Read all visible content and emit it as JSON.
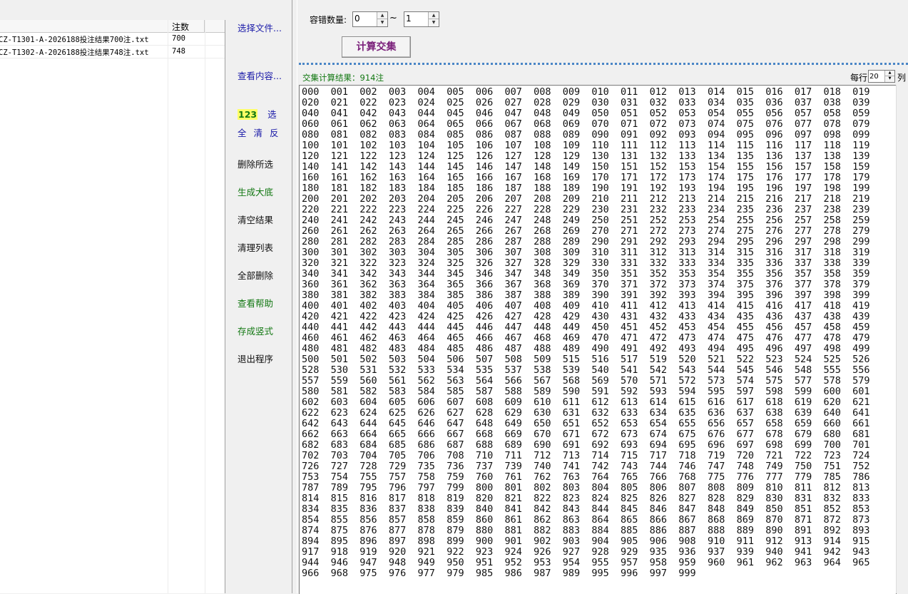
{
  "file_list": {
    "columns": [
      "",
      "注数"
    ],
    "rows": [
      {
        "name": "CZ-T1301-A-2026188投注结果700注.txt",
        "count": "700"
      },
      {
        "name": "CZ-T1302-A-2026188投注结果748注.txt",
        "count": "748"
      }
    ]
  },
  "middle": {
    "select_file": "选择文件...",
    "view_content": "查看内容...",
    "num_badge": "123",
    "select": "选",
    "select_all": "全",
    "clear": "清",
    "invert": "反",
    "delete_selected": "删除所选",
    "generate_base": "生成大底",
    "clear_result": "清空结果",
    "clean_list": "清理列表",
    "delete_all": "全部删除",
    "view_help": "查看帮助",
    "save_vertical": "存成竖式",
    "exit": "退出程序"
  },
  "controls": {
    "tolerance_label": "容错数量:",
    "tolerance_min": "0",
    "tilde": "~",
    "tolerance_max": "1",
    "calc_button": "计算交集"
  },
  "result": {
    "title": "交集计算结果：914注",
    "per_row_label": "每行",
    "per_row_value": "20",
    "per_row_unit": "列",
    "numbers": [
      "000",
      "001",
      "002",
      "003",
      "004",
      "005",
      "006",
      "007",
      "008",
      "009",
      "010",
      "011",
      "012",
      "013",
      "014",
      "015",
      "016",
      "017",
      "018",
      "019",
      "020",
      "021",
      "022",
      "023",
      "024",
      "025",
      "026",
      "027",
      "028",
      "029",
      "030",
      "031",
      "032",
      "033",
      "034",
      "035",
      "036",
      "037",
      "038",
      "039",
      "040",
      "041",
      "042",
      "043",
      "044",
      "045",
      "046",
      "047",
      "048",
      "049",
      "050",
      "051",
      "052",
      "053",
      "054",
      "055",
      "056",
      "057",
      "058",
      "059",
      "060",
      "061",
      "062",
      "063",
      "064",
      "065",
      "066",
      "067",
      "068",
      "069",
      "070",
      "071",
      "072",
      "073",
      "074",
      "075",
      "076",
      "077",
      "078",
      "079",
      "080",
      "081",
      "082",
      "083",
      "084",
      "085",
      "086",
      "087",
      "088",
      "089",
      "090",
      "091",
      "092",
      "093",
      "094",
      "095",
      "096",
      "097",
      "098",
      "099",
      "100",
      "101",
      "102",
      "103",
      "104",
      "105",
      "106",
      "107",
      "108",
      "109",
      "110",
      "111",
      "112",
      "113",
      "114",
      "115",
      "116",
      "117",
      "118",
      "119",
      "120",
      "121",
      "122",
      "123",
      "124",
      "125",
      "126",
      "127",
      "128",
      "129",
      "130",
      "131",
      "132",
      "133",
      "134",
      "135",
      "136",
      "137",
      "138",
      "139",
      "140",
      "141",
      "142",
      "143",
      "144",
      "145",
      "146",
      "147",
      "148",
      "149",
      "150",
      "151",
      "152",
      "153",
      "154",
      "155",
      "156",
      "157",
      "158",
      "159",
      "160",
      "161",
      "162",
      "163",
      "164",
      "165",
      "166",
      "167",
      "168",
      "169",
      "170",
      "171",
      "172",
      "173",
      "174",
      "175",
      "176",
      "177",
      "178",
      "179",
      "180",
      "181",
      "182",
      "183",
      "184",
      "185",
      "186",
      "187",
      "188",
      "189",
      "190",
      "191",
      "192",
      "193",
      "194",
      "195",
      "196",
      "197",
      "198",
      "199",
      "200",
      "201",
      "202",
      "203",
      "204",
      "205",
      "206",
      "207",
      "208",
      "209",
      "210",
      "211",
      "212",
      "213",
      "214",
      "215",
      "216",
      "217",
      "218",
      "219",
      "220",
      "221",
      "222",
      "223",
      "224",
      "225",
      "226",
      "227",
      "228",
      "229",
      "230",
      "231",
      "232",
      "233",
      "234",
      "235",
      "236",
      "237",
      "238",
      "239",
      "240",
      "241",
      "242",
      "243",
      "244",
      "245",
      "246",
      "247",
      "248",
      "249",
      "250",
      "251",
      "252",
      "253",
      "254",
      "255",
      "256",
      "257",
      "258",
      "259",
      "260",
      "261",
      "262",
      "263",
      "264",
      "265",
      "266",
      "267",
      "268",
      "269",
      "270",
      "271",
      "272",
      "273",
      "274",
      "275",
      "276",
      "277",
      "278",
      "279",
      "280",
      "281",
      "282",
      "283",
      "284",
      "285",
      "286",
      "287",
      "288",
      "289",
      "290",
      "291",
      "292",
      "293",
      "294",
      "295",
      "296",
      "297",
      "298",
      "299",
      "300",
      "301",
      "302",
      "303",
      "304",
      "305",
      "306",
      "307",
      "308",
      "309",
      "310",
      "311",
      "312",
      "313",
      "314",
      "315",
      "316",
      "317",
      "318",
      "319",
      "320",
      "321",
      "322",
      "323",
      "324",
      "325",
      "326",
      "327",
      "328",
      "329",
      "330",
      "331",
      "332",
      "333",
      "334",
      "335",
      "336",
      "337",
      "338",
      "339",
      "340",
      "341",
      "342",
      "343",
      "344",
      "345",
      "346",
      "347",
      "348",
      "349",
      "350",
      "351",
      "352",
      "353",
      "354",
      "355",
      "356",
      "357",
      "358",
      "359",
      "360",
      "361",
      "362",
      "363",
      "364",
      "365",
      "366",
      "367",
      "368",
      "369",
      "370",
      "371",
      "372",
      "373",
      "374",
      "375",
      "376",
      "377",
      "378",
      "379",
      "380",
      "381",
      "382",
      "383",
      "384",
      "385",
      "386",
      "387",
      "388",
      "389",
      "390",
      "391",
      "392",
      "393",
      "394",
      "395",
      "396",
      "397",
      "398",
      "399",
      "400",
      "401",
      "402",
      "403",
      "404",
      "405",
      "406",
      "407",
      "408",
      "409",
      "410",
      "411",
      "412",
      "413",
      "414",
      "415",
      "416",
      "417",
      "418",
      "419",
      "420",
      "421",
      "422",
      "423",
      "424",
      "425",
      "426",
      "427",
      "428",
      "429",
      "430",
      "431",
      "432",
      "433",
      "434",
      "435",
      "436",
      "437",
      "438",
      "439",
      "440",
      "441",
      "442",
      "443",
      "444",
      "445",
      "446",
      "447",
      "448",
      "449",
      "450",
      "451",
      "452",
      "453",
      "454",
      "455",
      "456",
      "457",
      "458",
      "459",
      "460",
      "461",
      "462",
      "463",
      "464",
      "465",
      "466",
      "467",
      "468",
      "469",
      "470",
      "471",
      "472",
      "473",
      "474",
      "475",
      "476",
      "477",
      "478",
      "479",
      "480",
      "481",
      "482",
      "483",
      "484",
      "485",
      "486",
      "487",
      "488",
      "489",
      "490",
      "491",
      "492",
      "493",
      "494",
      "495",
      "496",
      "497",
      "498",
      "499",
      "500",
      "501",
      "502",
      "503",
      "504",
      "506",
      "507",
      "508",
      "509",
      "515",
      "516",
      "517",
      "519",
      "520",
      "521",
      "522",
      "523",
      "524",
      "525",
      "526",
      "528",
      "530",
      "531",
      "532",
      "533",
      "534",
      "535",
      "537",
      "538",
      "539",
      "540",
      "541",
      "542",
      "543",
      "544",
      "545",
      "546",
      "548",
      "555",
      "556",
      "557",
      "559",
      "560",
      "561",
      "562",
      "563",
      "564",
      "566",
      "567",
      "568",
      "569",
      "570",
      "571",
      "572",
      "573",
      "574",
      "575",
      "577",
      "578",
      "579",
      "580",
      "581",
      "582",
      "583",
      "584",
      "585",
      "587",
      "588",
      "589",
      "590",
      "591",
      "592",
      "593",
      "594",
      "595",
      "597",
      "598",
      "599",
      "600",
      "601",
      "602",
      "603",
      "604",
      "605",
      "606",
      "607",
      "608",
      "609",
      "610",
      "611",
      "612",
      "613",
      "614",
      "615",
      "616",
      "617",
      "618",
      "619",
      "620",
      "621",
      "622",
      "623",
      "624",
      "625",
      "626",
      "627",
      "628",
      "629",
      "630",
      "631",
      "632",
      "633",
      "634",
      "635",
      "636",
      "637",
      "638",
      "639",
      "640",
      "641",
      "642",
      "643",
      "644",
      "645",
      "646",
      "647",
      "648",
      "649",
      "650",
      "651",
      "652",
      "653",
      "654",
      "655",
      "656",
      "657",
      "658",
      "659",
      "660",
      "661",
      "662",
      "663",
      "664",
      "665",
      "666",
      "667",
      "668",
      "669",
      "670",
      "671",
      "672",
      "673",
      "674",
      "675",
      "676",
      "677",
      "678",
      "679",
      "680",
      "681",
      "682",
      "683",
      "684",
      "685",
      "686",
      "687",
      "688",
      "689",
      "690",
      "691",
      "692",
      "693",
      "694",
      "695",
      "696",
      "697",
      "698",
      "699",
      "700",
      "701",
      "702",
      "703",
      "704",
      "705",
      "706",
      "708",
      "710",
      "711",
      "712",
      "713",
      "714",
      "715",
      "717",
      "718",
      "719",
      "720",
      "721",
      "722",
      "723",
      "724",
      "726",
      "727",
      "728",
      "729",
      "735",
      "736",
      "737",
      "739",
      "740",
      "741",
      "742",
      "743",
      "744",
      "746",
      "747",
      "748",
      "749",
      "750",
      "751",
      "752",
      "753",
      "754",
      "755",
      "757",
      "758",
      "759",
      "760",
      "761",
      "762",
      "763",
      "764",
      "765",
      "766",
      "768",
      "775",
      "776",
      "777",
      "779",
      "785",
      "786",
      "787",
      "789",
      "795",
      "796",
      "797",
      "799",
      "800",
      "801",
      "802",
      "803",
      "804",
      "805",
      "806",
      "807",
      "808",
      "809",
      "810",
      "811",
      "812",
      "813",
      "814",
      "815",
      "816",
      "817",
      "818",
      "819",
      "820",
      "821",
      "822",
      "823",
      "824",
      "825",
      "826",
      "827",
      "828",
      "829",
      "830",
      "831",
      "832",
      "833",
      "834",
      "835",
      "836",
      "837",
      "838",
      "839",
      "840",
      "841",
      "842",
      "843",
      "844",
      "845",
      "846",
      "847",
      "848",
      "849",
      "850",
      "851",
      "852",
      "853",
      "854",
      "855",
      "856",
      "857",
      "858",
      "859",
      "860",
      "861",
      "862",
      "863",
      "864",
      "865",
      "866",
      "867",
      "868",
      "869",
      "870",
      "871",
      "872",
      "873",
      "874",
      "875",
      "876",
      "877",
      "878",
      "879",
      "880",
      "881",
      "882",
      "883",
      "884",
      "885",
      "886",
      "887",
      "888",
      "889",
      "890",
      "891",
      "892",
      "893",
      "894",
      "895",
      "896",
      "897",
      "898",
      "899",
      "900",
      "901",
      "902",
      "903",
      "904",
      "905",
      "906",
      "908",
      "910",
      "911",
      "912",
      "913",
      "914",
      "915",
      "917",
      "918",
      "919",
      "920",
      "921",
      "922",
      "923",
      "924",
      "926",
      "927",
      "928",
      "929",
      "935",
      "936",
      "937",
      "939",
      "940",
      "941",
      "942",
      "943",
      "944",
      "946",
      "947",
      "948",
      "949",
      "950",
      "951",
      "952",
      "953",
      "954",
      "955",
      "957",
      "958",
      "959",
      "960",
      "961",
      "962",
      "963",
      "964",
      "965",
      "966",
      "968",
      "975",
      "976",
      "977",
      "979",
      "985",
      "986",
      "987",
      "989",
      "995",
      "996",
      "997",
      "999"
    ]
  },
  "colors": {
    "link_blue": "#1a1aa8",
    "action_green": "#117711",
    "calc_purple": "#7a1f7a",
    "badge_yellow": "#ffff66",
    "separator_blue": "#4a86c6"
  }
}
